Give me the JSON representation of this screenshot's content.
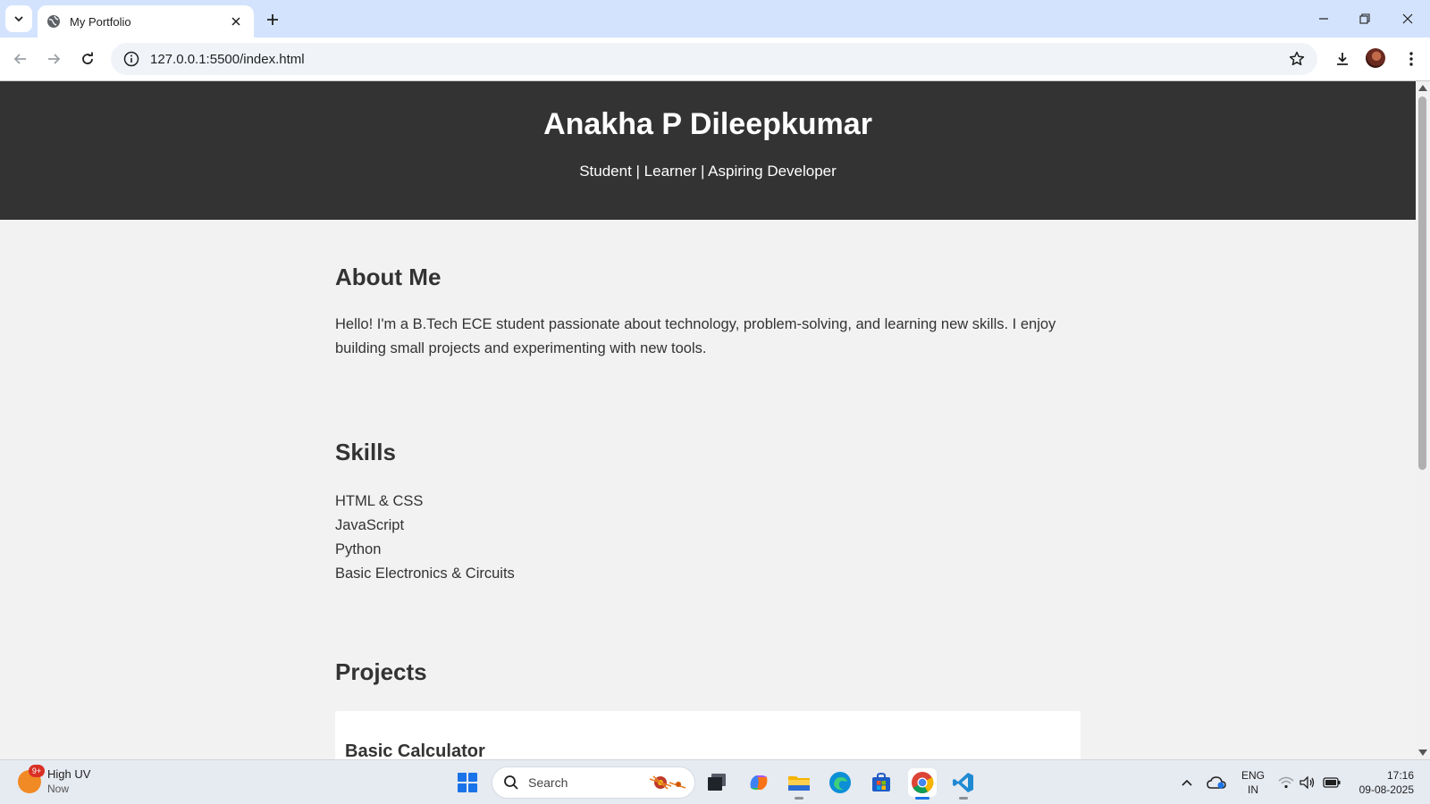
{
  "browser": {
    "tab_title": "My Portfolio",
    "url": "127.0.0.1:5500/index.html"
  },
  "page": {
    "header": {
      "name": "Anakha P Dileepkumar",
      "tagline": "Student | Learner | Aspiring Developer"
    },
    "about": {
      "title": "About Me",
      "text": "Hello! I'm a B.Tech ECE student passionate about technology, problem-solving, and learning new skills. I enjoy building small projects and experimenting with new tools."
    },
    "skills": {
      "title": "Skills",
      "items": [
        "HTML & CSS",
        "JavaScript",
        "Python",
        "Basic Electronics & Circuits"
      ]
    },
    "projects": {
      "title": "Projects",
      "items": [
        {
          "title": "Basic Calculator"
        }
      ]
    }
  },
  "taskbar": {
    "weather": {
      "title": "High UV",
      "subtitle": "Now",
      "badge": "9+"
    },
    "search_placeholder": "Search",
    "language": {
      "line1": "ENG",
      "line2": "IN"
    },
    "clock": {
      "time": "17:16",
      "date": "09-08-2025"
    }
  },
  "colors": {
    "header_bg": "#333333",
    "page_bg": "#f2f2f2",
    "tabbar_bg": "#d3e3fd",
    "accent": "#1a73e8"
  }
}
